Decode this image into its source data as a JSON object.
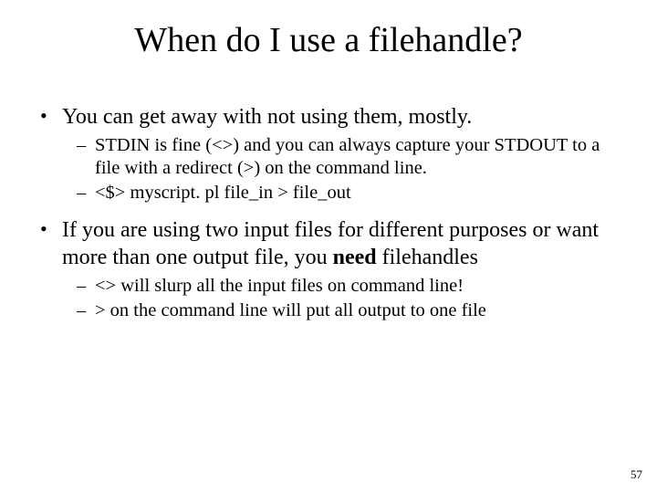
{
  "title": "When do I use a filehandle?",
  "bullets": {
    "b1": {
      "text": "You can get away with not using them, mostly.",
      "sub": {
        "s1": "STDIN is fine (<>) and you can always capture your STDOUT to a file with a redirect (>) on the command line.",
        "s2": "<$> myscript. pl file_in > file_out"
      }
    },
    "b2": {
      "pre": "If you are using two input files for different purposes or want more than one output file, you ",
      "bold": "need",
      "post": " filehandles",
      "sub": {
        "s1": "<> will slurp all the input files on command line!",
        "s2": "> on the command line will put all output to one file"
      }
    }
  },
  "page_number": "57"
}
